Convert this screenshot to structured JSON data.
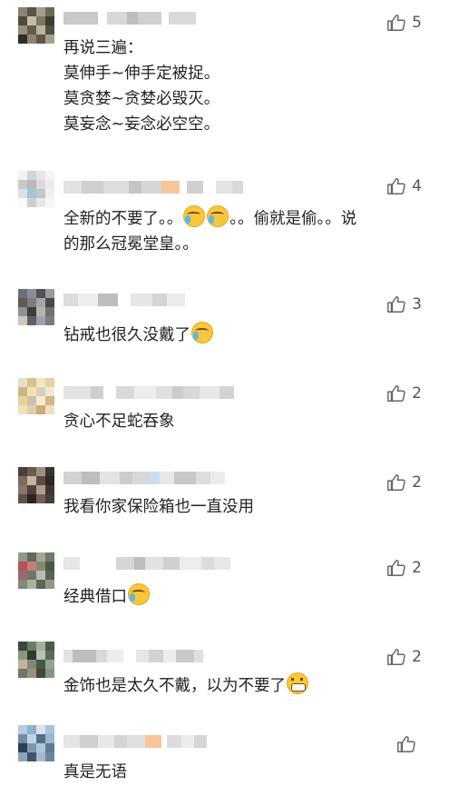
{
  "comments": [
    {
      "likes": "5",
      "lines": "再说三遍：\n莫伸手~伸手定被捉。\n莫贪婪~贪婪必毁灭。\n莫妄念~妄念必空空。",
      "emoji": ""
    },
    {
      "likes": "4",
      "lines_before": "全新的不要了。。",
      "lines_after": "。。偷就是偷。。说\n的那么冠冕堂皇。。",
      "emoji": "cry-cry"
    },
    {
      "likes": "3",
      "lines": "钻戒也很久没戴了",
      "emoji": "cry"
    },
    {
      "likes": "2",
      "lines": "贪心不足蛇吞象",
      "emoji": ""
    },
    {
      "likes": "2",
      "lines": "我看你家保险箱也一直没用",
      "emoji": ""
    },
    {
      "likes": "2",
      "lines": "经典借口",
      "emoji": "cry"
    },
    {
      "likes": "2",
      "lines": "金饰也是太久不戴，以为不要了",
      "emoji": "grin"
    },
    {
      "likes": "",
      "lines": "真是无语",
      "emoji": ""
    }
  ],
  "icons": {
    "like": "thumbs-up-icon",
    "cry": "laugh-cry-emoji",
    "grin": "grin-emoji"
  }
}
